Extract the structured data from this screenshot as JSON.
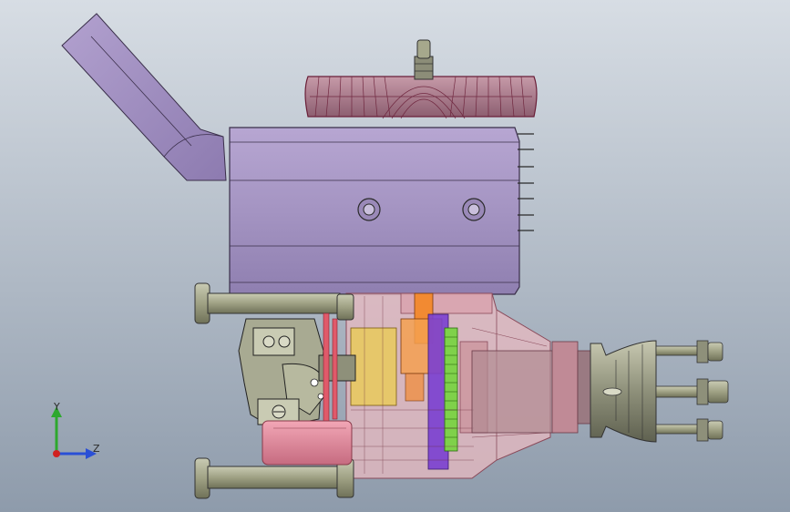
{
  "colors": {
    "background_top": "#d7dde4",
    "background_bottom": "#8e9bab",
    "cylinder_fill": "#a896c4",
    "pipe_fill": "#9d8ab9",
    "crankcase_fill": "#e8b9c0",
    "outline": "#3a2f4a",
    "head_fill": "#b38a98",
    "head_edge": "#6a1f38",
    "orange": "#f28a32",
    "yellow": "#e6c76a",
    "green": "#7fd14a",
    "purple": "#7a3fd0",
    "pink": "#e58ea0",
    "rod_fill": "#a6a88c",
    "axis_y": "#2ea82e",
    "axis_z": "#2a4fd6",
    "axis_origin": "#d02020"
  },
  "triad": {
    "y_label": "Y",
    "z_label": "Z"
  },
  "icons": [
    "coordinate-triad-icon"
  ]
}
